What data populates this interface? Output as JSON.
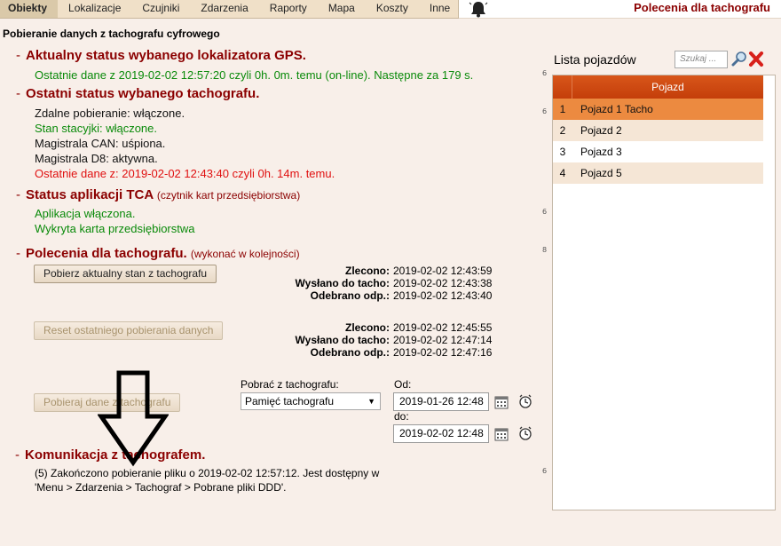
{
  "menu": {
    "tabs": [
      "Obiekty",
      "Lokalizacje",
      "Czujniki",
      "Zdarzenia",
      "Raporty",
      "Mapa",
      "Koszty",
      "Inne"
    ],
    "active_tab": "Obiekty",
    "page_title": "Polecenia dla tachografu"
  },
  "main": {
    "heading": "Pobieranie danych z tachografu cyfrowego",
    "gps": {
      "title": "Aktualny status wybanego lokalizatora GPS.",
      "line": "Ostatnie dane z 2019-02-02 12:57:20 czyli 0h. 0m. temu (on-line). Następne za 179 s."
    },
    "tacho": {
      "title": "Ostatni status wybanego tachografu.",
      "lines": [
        "Zdalne pobieranie: włączone.",
        "Stan stacyjki: włączone.",
        "Magistrala CAN: uśpiona.",
        "Magistrala D8: aktywna.",
        "Ostatnie dane z: 2019-02-02 12:43:40 czyli 0h. 14m. temu."
      ]
    },
    "tca": {
      "title": "Status aplikacji TCA",
      "note": "(czytnik kart przedsiębiorstwa)",
      "lines": [
        "Aplikacja włączona.",
        "Wykryta karta przedsiębiorstwa"
      ]
    },
    "commands": {
      "title": "Polecenia dla tachografu.",
      "note": "(wykonać w kolejności)",
      "btn1": "Pobierz aktualny stan z tachografu",
      "btn2": "Reset ostatniego pobierania danych",
      "btn3": "Pobieraj dane z tachografu",
      "labels": {
        "ordered": "Zlecono:",
        "sent": "Wysłano do tacho:",
        "received": "Odebrano odp.:"
      },
      "cmd1": {
        "ordered": "2019-02-02 12:43:59",
        "sent": "2019-02-02 12:43:38",
        "received": "2019-02-02 12:43:40"
      },
      "cmd2": {
        "ordered": "2019-02-02 12:45:55",
        "sent": "2019-02-02 12:47:14",
        "received": "2019-02-02 12:47:16"
      },
      "download_label": "Pobrać z tachografu:",
      "download_select": "Pamięć tachografu",
      "from_label": "Od:",
      "from_value": "2019-01-26 12:48",
      "to_label": "do:",
      "to_value": "2019-02-02 12:48"
    },
    "comm": {
      "title": "Komunikacja z tachografem.",
      "text": "(5) Zakończono pobieranie pliku o 2019-02-02 12:57:12. Jest dostępny w 'Menu > Zdarzenia > Tachograf > Pobrane pliki DDD'."
    },
    "margin_marks": [
      "6",
      "6",
      "6",
      "8",
      "6"
    ]
  },
  "vehicles": {
    "title": "Lista pojazdów",
    "search_placeholder": "Szukaj ...",
    "column": "Pojazd",
    "rows": [
      {
        "num": "1",
        "name": "Pojazd 1 Tacho"
      },
      {
        "num": "2",
        "name": "Pojazd 2"
      },
      {
        "num": "3",
        "name": "Pojazd 3"
      },
      {
        "num": "4",
        "name": "Pojazd 5"
      }
    ]
  },
  "colors": {
    "title_red": "#8b0000",
    "ok_green": "#0a8a0a",
    "warn_red": "#e01010",
    "header_orange": "#c9470f",
    "selected_row": "#ec8a40"
  }
}
